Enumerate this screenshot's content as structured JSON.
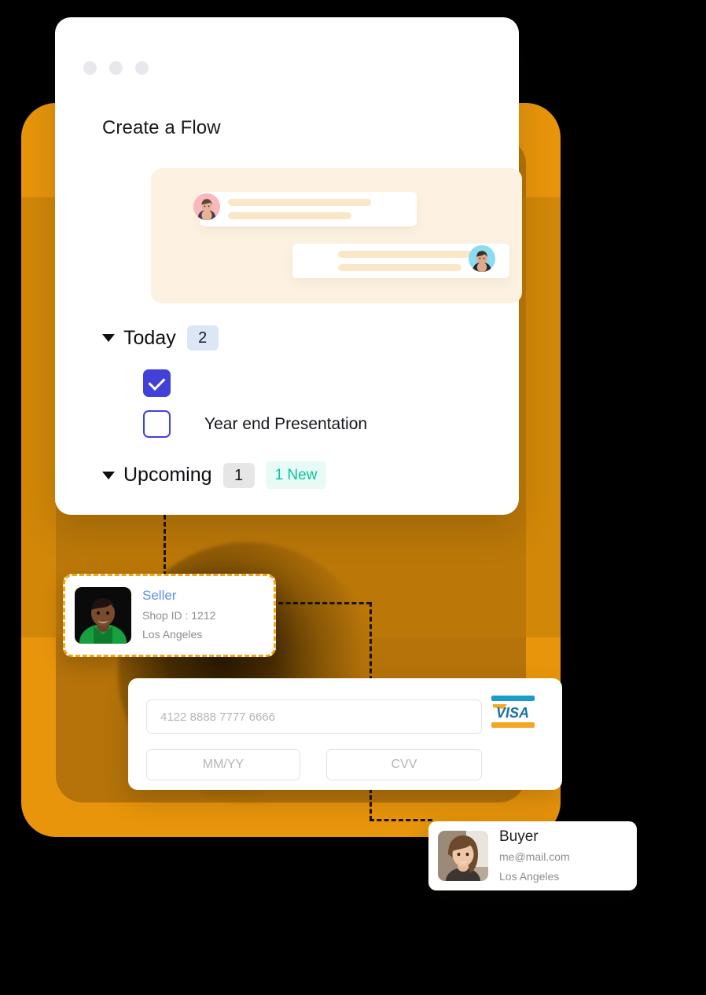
{
  "window": {
    "title": "Create a Flow",
    "traffic_dots": [
      "dot-1",
      "dot-2",
      "dot-3"
    ]
  },
  "chat": {
    "messages": [
      {
        "side": "left",
        "avatar": "avatar-pink",
        "lines": 2
      },
      {
        "side": "right",
        "avatar": "avatar-blue",
        "lines": 2
      }
    ]
  },
  "sections": {
    "today": {
      "label": "Today",
      "count": "2",
      "caret": "caret-down-icon",
      "tasks": [
        {
          "checked": true,
          "label": ""
        },
        {
          "checked": false,
          "label": "Year end Presentation"
        }
      ]
    },
    "upcoming": {
      "label": "Upcoming",
      "count": "1",
      "new_badge": "1 New",
      "caret": "caret-down-icon"
    }
  },
  "seller": {
    "name": "Seller",
    "shop_id": "Shop ID : 1212",
    "location": "Los Angeles"
  },
  "buyer": {
    "name": "Buyer",
    "email": "me@mail.com",
    "location": "Los Angeles"
  },
  "payment": {
    "card_number_placeholder": "4122 8888 7777 6666",
    "card_number_value": "",
    "expiry_placeholder": "MM/YY",
    "expiry_value": "",
    "cvv_placeholder": "CVV",
    "cvv_value": "",
    "brand": "VISA",
    "brand_icon": "visa-card-icon"
  },
  "colors": {
    "backdrop_orange": "#e8950b",
    "backdrop_orange_dark": "#b5730a",
    "checkbox_indigo": "#4141d8",
    "badge_blue": "#dbe7f7",
    "badge_grey": "#e6e6e6",
    "new_teal_text": "#0ec2a1",
    "new_teal_bg": "#e8faf5",
    "chat_panel_cream": "#fdf2e2",
    "chat_line_tan": "#fae7c7",
    "seller_link_blue": "#5b92e8",
    "dashed_border_orange": "#f5a310",
    "visa_blue": "#1a9ccd",
    "visa_orange": "#f5a623"
  }
}
